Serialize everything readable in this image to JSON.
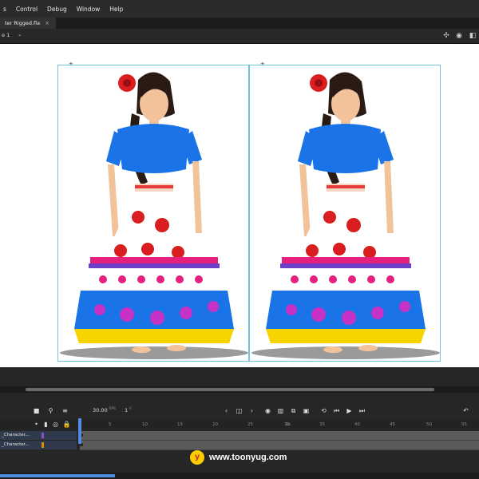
{
  "menubar": {
    "items": [
      "s",
      "Control",
      "Debug",
      "Window",
      "Help"
    ]
  },
  "document": {
    "tab_title": "ter Rigged.fla",
    "close": "×"
  },
  "editbar": {
    "scene_label": "e 1",
    "icons": [
      "snap-icon",
      "camera-icon",
      "layers-icon",
      "fit-stage-icon"
    ]
  },
  "timeline": {
    "fps_value": "30.00",
    "fps_unit": "FPS",
    "frame_value": "1",
    "frame_unit": "F",
    "ruler_fps": "1s",
    "ruler_ticks": [
      "5",
      "10",
      "15",
      "20",
      "25",
      "30",
      "35",
      "40",
      "45",
      "50",
      "55"
    ],
    "layers": [
      {
        "name": "_Character...",
        "color": "#8a4fd1"
      },
      {
        "name": "_Character...",
        "color": "#e08a00"
      }
    ]
  },
  "watermark": {
    "logo": "y",
    "text": "www.toonyug.com"
  },
  "colors": {
    "accent": "#4f8de0",
    "frame_border": "#6fc3dc",
    "stage": "#ffffff",
    "dress_blue": "#1a74e8",
    "rose": "#d81e1e"
  }
}
